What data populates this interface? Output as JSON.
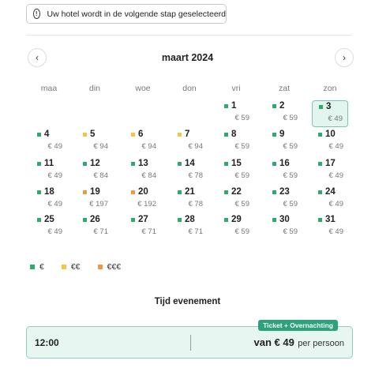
{
  "notice": {
    "icon": "info-icon",
    "icon_glyph": "!",
    "text": "Uw hotel wordt in de volgende stap geselecteerd"
  },
  "calendar": {
    "month": "maart 2024",
    "prev_icon": "chevron-left-icon",
    "next_icon": "chevron-right-icon",
    "prev_glyph": "‹",
    "next_glyph": "›",
    "weekdays": [
      "maa",
      "din",
      "woe",
      "don",
      "vri",
      "zat",
      "zon"
    ],
    "selected_day": "3",
    "days": [
      {
        "day": "1",
        "price": "€ 59",
        "tier": "low"
      },
      {
        "day": "2",
        "price": "€ 59",
        "tier": "low"
      },
      {
        "day": "3",
        "price": "€ 49",
        "tier": "low"
      },
      {
        "day": "4",
        "price": "€ 49",
        "tier": "low"
      },
      {
        "day": "5",
        "price": "€ 94",
        "tier": "mid"
      },
      {
        "day": "6",
        "price": "€ 94",
        "tier": "mid"
      },
      {
        "day": "7",
        "price": "€ 94",
        "tier": "mid"
      },
      {
        "day": "8",
        "price": "€ 59",
        "tier": "low"
      },
      {
        "day": "9",
        "price": "€ 59",
        "tier": "low"
      },
      {
        "day": "10",
        "price": "€ 49",
        "tier": "low"
      },
      {
        "day": "11",
        "price": "€ 49",
        "tier": "low"
      },
      {
        "day": "12",
        "price": "€ 84",
        "tier": "low"
      },
      {
        "day": "13",
        "price": "€ 84",
        "tier": "low"
      },
      {
        "day": "14",
        "price": "€ 78",
        "tier": "low"
      },
      {
        "day": "15",
        "price": "€ 59",
        "tier": "low"
      },
      {
        "day": "16",
        "price": "€ 59",
        "tier": "low"
      },
      {
        "day": "17",
        "price": "€ 49",
        "tier": "low"
      },
      {
        "day": "18",
        "price": "€ 49",
        "tier": "low"
      },
      {
        "day": "19",
        "price": "€ 197",
        "tier": "high"
      },
      {
        "day": "20",
        "price": "€ 192",
        "tier": "high"
      },
      {
        "day": "21",
        "price": "€ 78",
        "tier": "low"
      },
      {
        "day": "22",
        "price": "€ 59",
        "tier": "low"
      },
      {
        "day": "23",
        "price": "€ 59",
        "tier": "low"
      },
      {
        "day": "24",
        "price": "€ 49",
        "tier": "low"
      },
      {
        "day": "25",
        "price": "€ 49",
        "tier": "low"
      },
      {
        "day": "26",
        "price": "€ 71",
        "tier": "low"
      },
      {
        "day": "27",
        "price": "€ 71",
        "tier": "low"
      },
      {
        "day": "28",
        "price": "€ 71",
        "tier": "low"
      },
      {
        "day": "29",
        "price": "€ 59",
        "tier": "low"
      },
      {
        "day": "30",
        "price": "€ 59",
        "tier": "low"
      },
      {
        "day": "31",
        "price": "€ 49",
        "tier": "low"
      }
    ]
  },
  "legend": [
    {
      "tier": "low",
      "label": "€"
    },
    {
      "tier": "mid",
      "label": "€€"
    },
    {
      "tier": "high",
      "label": "€€€"
    }
  ],
  "tier_colors": {
    "low": "#2eaa6e",
    "mid": "#f5c542",
    "high": "#f0974a"
  },
  "colors": {
    "selected_bg": "#e2f5ee",
    "card_bg": "#e7f6f0",
    "badge_bg": "#2ba37a"
  },
  "event_time": {
    "title": "Tijd evenement",
    "badge": "Ticket + Overnachting",
    "time": "12:00",
    "price_from": "van € 49",
    "price_per": "per persoon"
  }
}
